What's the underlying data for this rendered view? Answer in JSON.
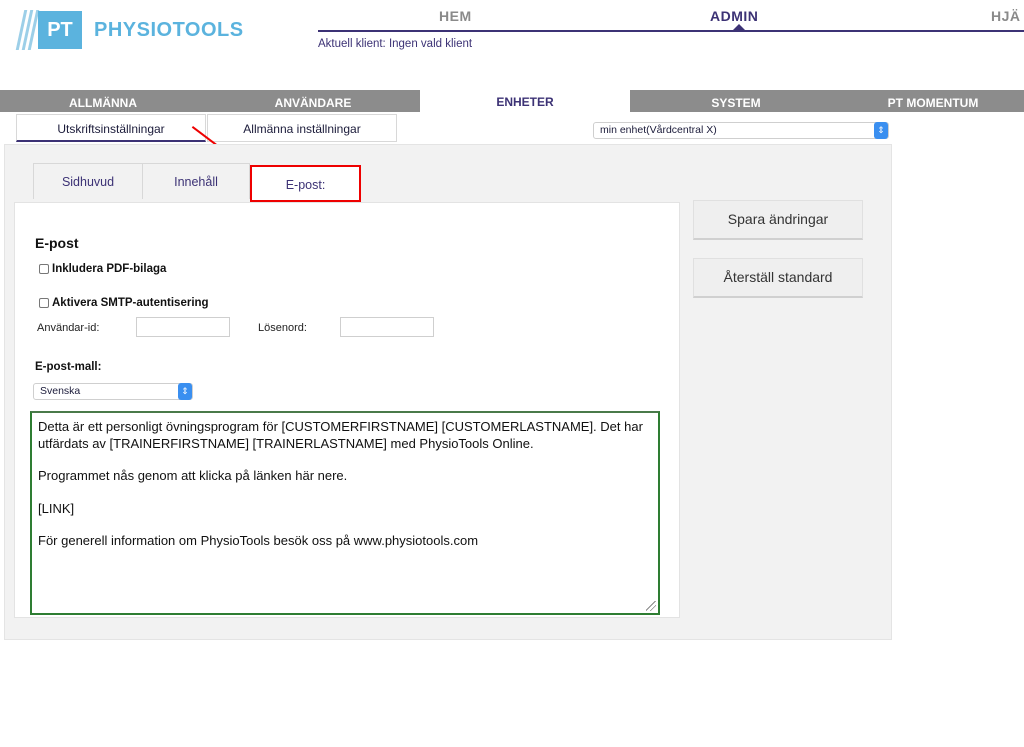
{
  "brand": {
    "mark": "PT",
    "name": "PHYSIOTOOLS"
  },
  "topnav": {
    "items": [
      "HEM",
      "ADMIN",
      "HJÄ"
    ],
    "active": "ADMIN"
  },
  "client_line": "Aktuell klient: Ingen vald klient",
  "main_tabs": [
    "ALLMÄNNA",
    "ANVÄNDARE",
    "ENHETER",
    "SYSTEM",
    "PT MOMENTUM"
  ],
  "sub_tabs": [
    "Utskriftsinställningar",
    "Allmänna inställningar"
  ],
  "unit_select": {
    "value": "min enhet(Vårdcentral X)"
  },
  "inner_tabs": [
    "Sidhuvud",
    "Innehåll",
    "E-post:"
  ],
  "email": {
    "heading": "E-post",
    "include_pdf": "Inkludera PDF-bilaga",
    "smtp_auth": "Aktivera SMTP-autentisering",
    "user_id_label": "Användar-id:",
    "password_label": "Lösenord:",
    "user_id_value": "",
    "password_value": "",
    "template_label": "E-post-mall:",
    "language": "Svenska",
    "template_lines": [
      "Detta är ett personligt övningsprogram för [CUSTOMERFIRSTNAME] [CUSTOMERLASTNAME]. Det har utfärdats av [TRAINERFIRSTNAME] [TRAINERLASTNAME] med PhysioTools Online.",
      "Programmet nås genom att klicka på länken här nere.",
      "[LINK]",
      "För generell information om PhysioTools besök oss på www.physiotools.com"
    ]
  },
  "buttons": {
    "save": "Spara ändringar",
    "reset": "Återställ standard"
  },
  "colors": {
    "brand_blue": "#5bb3de",
    "nav_purple": "#3c3275",
    "tab_gray": "#8c8c8c",
    "highlight_red": "#e00000",
    "textarea_green": "#2e7d32"
  }
}
